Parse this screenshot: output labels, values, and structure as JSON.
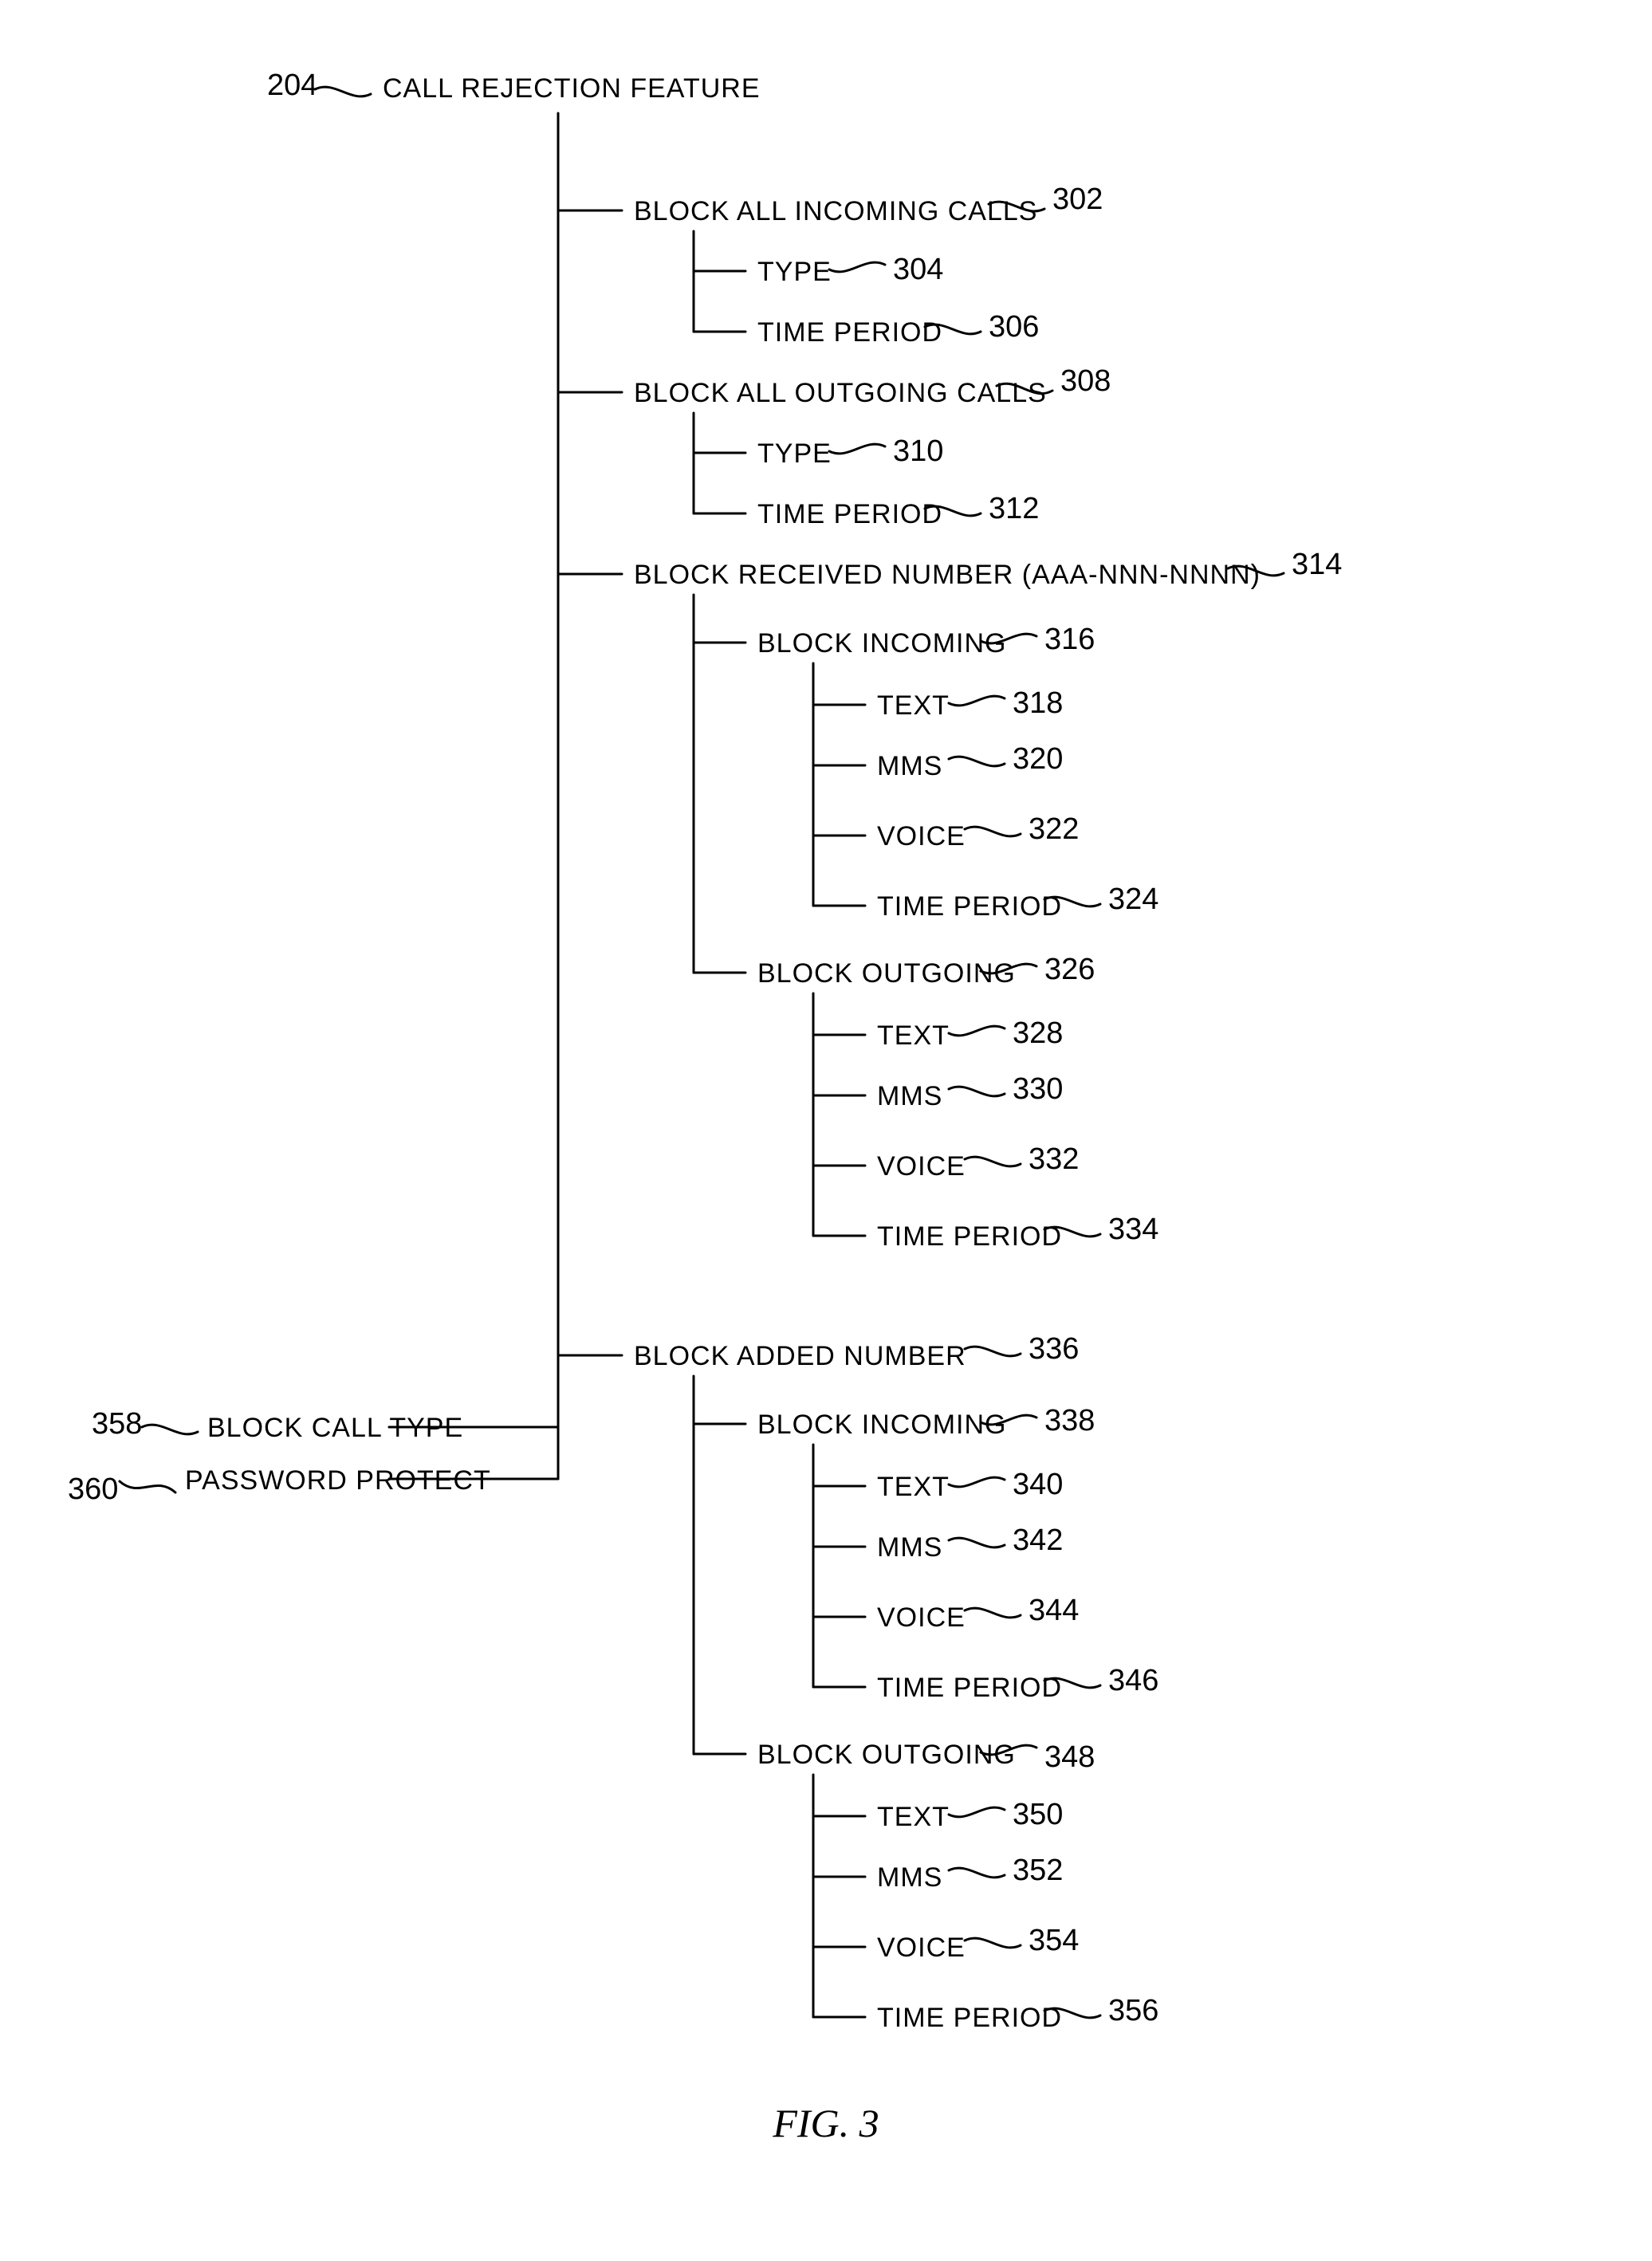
{
  "figure_label": "FIG. 3",
  "root": {
    "ref": "204",
    "label": "CALL REJECTION FEATURE"
  },
  "side_nodes": {
    "block_call_type": {
      "ref": "358",
      "label": "BLOCK CALL TYPE"
    },
    "password_protect": {
      "ref": "360",
      "label": "PASSWORD PROTECT"
    }
  },
  "nodes": {
    "block_all_incoming": {
      "ref": "302",
      "label": "BLOCK ALL INCOMING CALLS"
    },
    "bai_type": {
      "ref": "304",
      "label": "TYPE"
    },
    "bai_time": {
      "ref": "306",
      "label": "TIME PERIOD"
    },
    "block_all_outgoing": {
      "ref": "308",
      "label": "BLOCK ALL OUTGOING CALLS"
    },
    "bao_type": {
      "ref": "310",
      "label": "TYPE"
    },
    "bao_time": {
      "ref": "312",
      "label": "TIME PERIOD"
    },
    "block_received_number": {
      "ref": "314",
      "label": "BLOCK RECEIVED NUMBER (AAA-NNN-NNNN)"
    },
    "brn_in": {
      "ref": "316",
      "label": "BLOCK INCOMING"
    },
    "brn_in_text": {
      "ref": "318",
      "label": "TEXT"
    },
    "brn_in_mms": {
      "ref": "320",
      "label": "MMS"
    },
    "brn_in_voice": {
      "ref": "322",
      "label": "VOICE"
    },
    "brn_in_time": {
      "ref": "324",
      "label": "TIME PERIOD"
    },
    "brn_out": {
      "ref": "326",
      "label": "BLOCK OUTGOING"
    },
    "brn_out_text": {
      "ref": "328",
      "label": "TEXT"
    },
    "brn_out_mms": {
      "ref": "330",
      "label": "MMS"
    },
    "brn_out_voice": {
      "ref": "332",
      "label": "VOICE"
    },
    "brn_out_time": {
      "ref": "334",
      "label": "TIME PERIOD"
    },
    "block_added_number": {
      "ref": "336",
      "label": "BLOCK ADDED NUMBER"
    },
    "ban_in": {
      "ref": "338",
      "label": "BLOCK INCOMING"
    },
    "ban_in_text": {
      "ref": "340",
      "label": "TEXT"
    },
    "ban_in_mms": {
      "ref": "342",
      "label": "MMS"
    },
    "ban_in_voice": {
      "ref": "344",
      "label": "VOICE"
    },
    "ban_in_time": {
      "ref": "346",
      "label": "TIME PERIOD"
    },
    "ban_out": {
      "ref": "348",
      "label": "BLOCK OUTGOING"
    },
    "ban_out_text": {
      "ref": "350",
      "label": "TEXT"
    },
    "ban_out_mms": {
      "ref": "352",
      "label": "MMS"
    },
    "ban_out_voice": {
      "ref": "354",
      "label": "VOICE"
    },
    "ban_out_time": {
      "ref": "356",
      "label": "TIME PERIOD"
    }
  }
}
